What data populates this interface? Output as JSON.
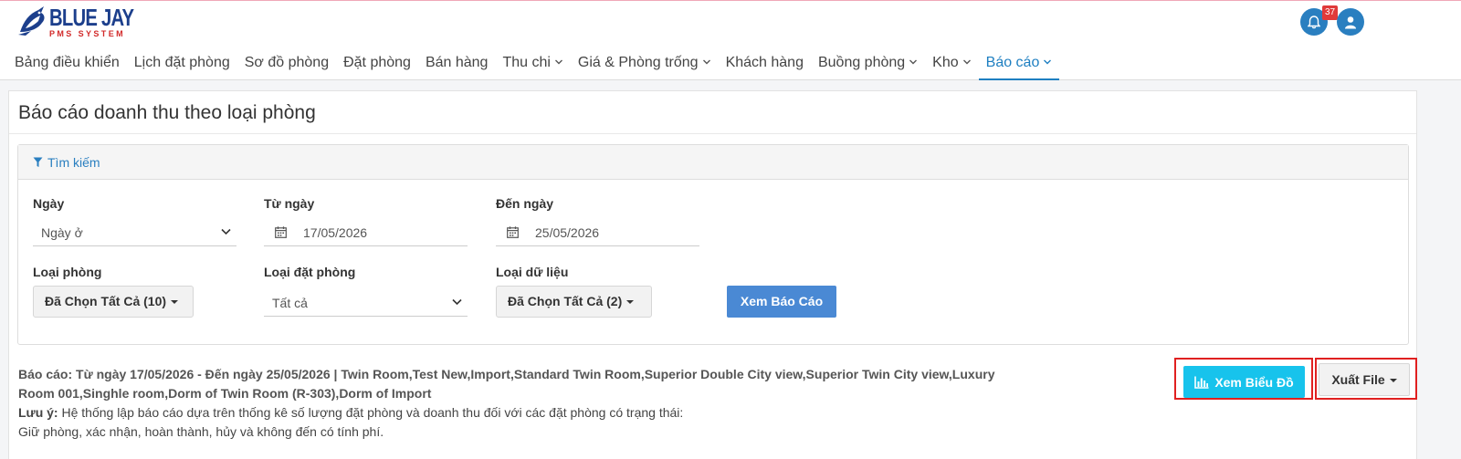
{
  "brand": {
    "name": "BLUE JAY",
    "sub": "PMS SYSTEM"
  },
  "notifications": {
    "count": "37"
  },
  "nav": [
    {
      "label": "Bảng điều khiển",
      "dropdown": false
    },
    {
      "label": "Lịch đặt phòng",
      "dropdown": false
    },
    {
      "label": "Sơ đồ phòng",
      "dropdown": false
    },
    {
      "label": "Đặt phòng",
      "dropdown": false
    },
    {
      "label": "Bán hàng",
      "dropdown": false
    },
    {
      "label": "Thu chi",
      "dropdown": true
    },
    {
      "label": "Giá & Phòng trống",
      "dropdown": true
    },
    {
      "label": "Khách hàng",
      "dropdown": false
    },
    {
      "label": "Buồng phòng",
      "dropdown": true
    },
    {
      "label": "Kho",
      "dropdown": true
    },
    {
      "label": "Báo cáo",
      "dropdown": true,
      "active": true
    }
  ],
  "page": {
    "title": "Báo cáo doanh thu theo loại phòng"
  },
  "search": {
    "header": "Tìm kiếm",
    "date_type": {
      "label": "Ngày",
      "value": "Ngày ở"
    },
    "from_date": {
      "label": "Từ ngày",
      "value": "17/05/2026"
    },
    "to_date": {
      "label": "Đến ngày",
      "value": "25/05/2026"
    },
    "room_type": {
      "label": "Loại phòng",
      "value": "Đã Chọn Tất Cả (10)"
    },
    "booking_type": {
      "label": "Loại đặt phòng",
      "value": "Tất cả"
    },
    "data_type": {
      "label": "Loại dữ liệu",
      "value": "Đã Chọn Tất Cả (2)"
    },
    "view_report": "Xem Báo Cáo"
  },
  "report": {
    "summary_line1": "Báo cáo: Từ ngày 17/05/2026 - Đến ngày 25/05/2026 | Twin Room,Test New,Import,Standard Twin Room,Superior Double City view,Superior Twin City view,Luxury",
    "summary_line2": "Room 001,Singhle room,Dorm of Twin Room (R-303),Dorm of Import",
    "note_label": "Lưu ý:",
    "note_text": " Hệ thống lập báo cáo dựa trên thống kê số lượng đặt phòng và doanh thu đối với các đặt phòng có trạng thái:",
    "note_line2": "Giữ phòng, xác nhận, hoàn thành, hủy và không đến có tính phí."
  },
  "actions": {
    "chart": "Xem Biểu Đồ",
    "export": "Xuất File"
  }
}
